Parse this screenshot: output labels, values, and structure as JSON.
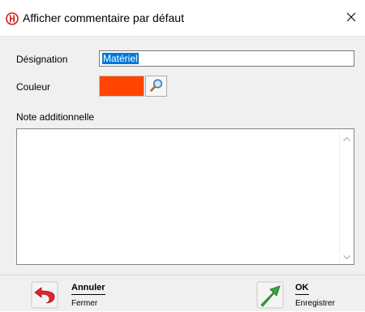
{
  "window": {
    "title": "Afficher commentaire par défaut"
  },
  "form": {
    "designation_label": "Désignation",
    "designation_value": "Matériel",
    "color_label": "Couleur",
    "color_value": "#ff4500",
    "note_label": "Note additionnelle",
    "note_value": ""
  },
  "footer": {
    "cancel": {
      "title": "Annuler",
      "subtitle": "Fermer"
    },
    "ok": {
      "title": "OK",
      "subtitle": "Enregistrer"
    }
  },
  "icons": {
    "app": "app-logo-icon",
    "close": "close-icon",
    "picker": "magnifier-icon",
    "cancel": "undo-arrow-icon",
    "ok": "green-arrow-icon"
  }
}
